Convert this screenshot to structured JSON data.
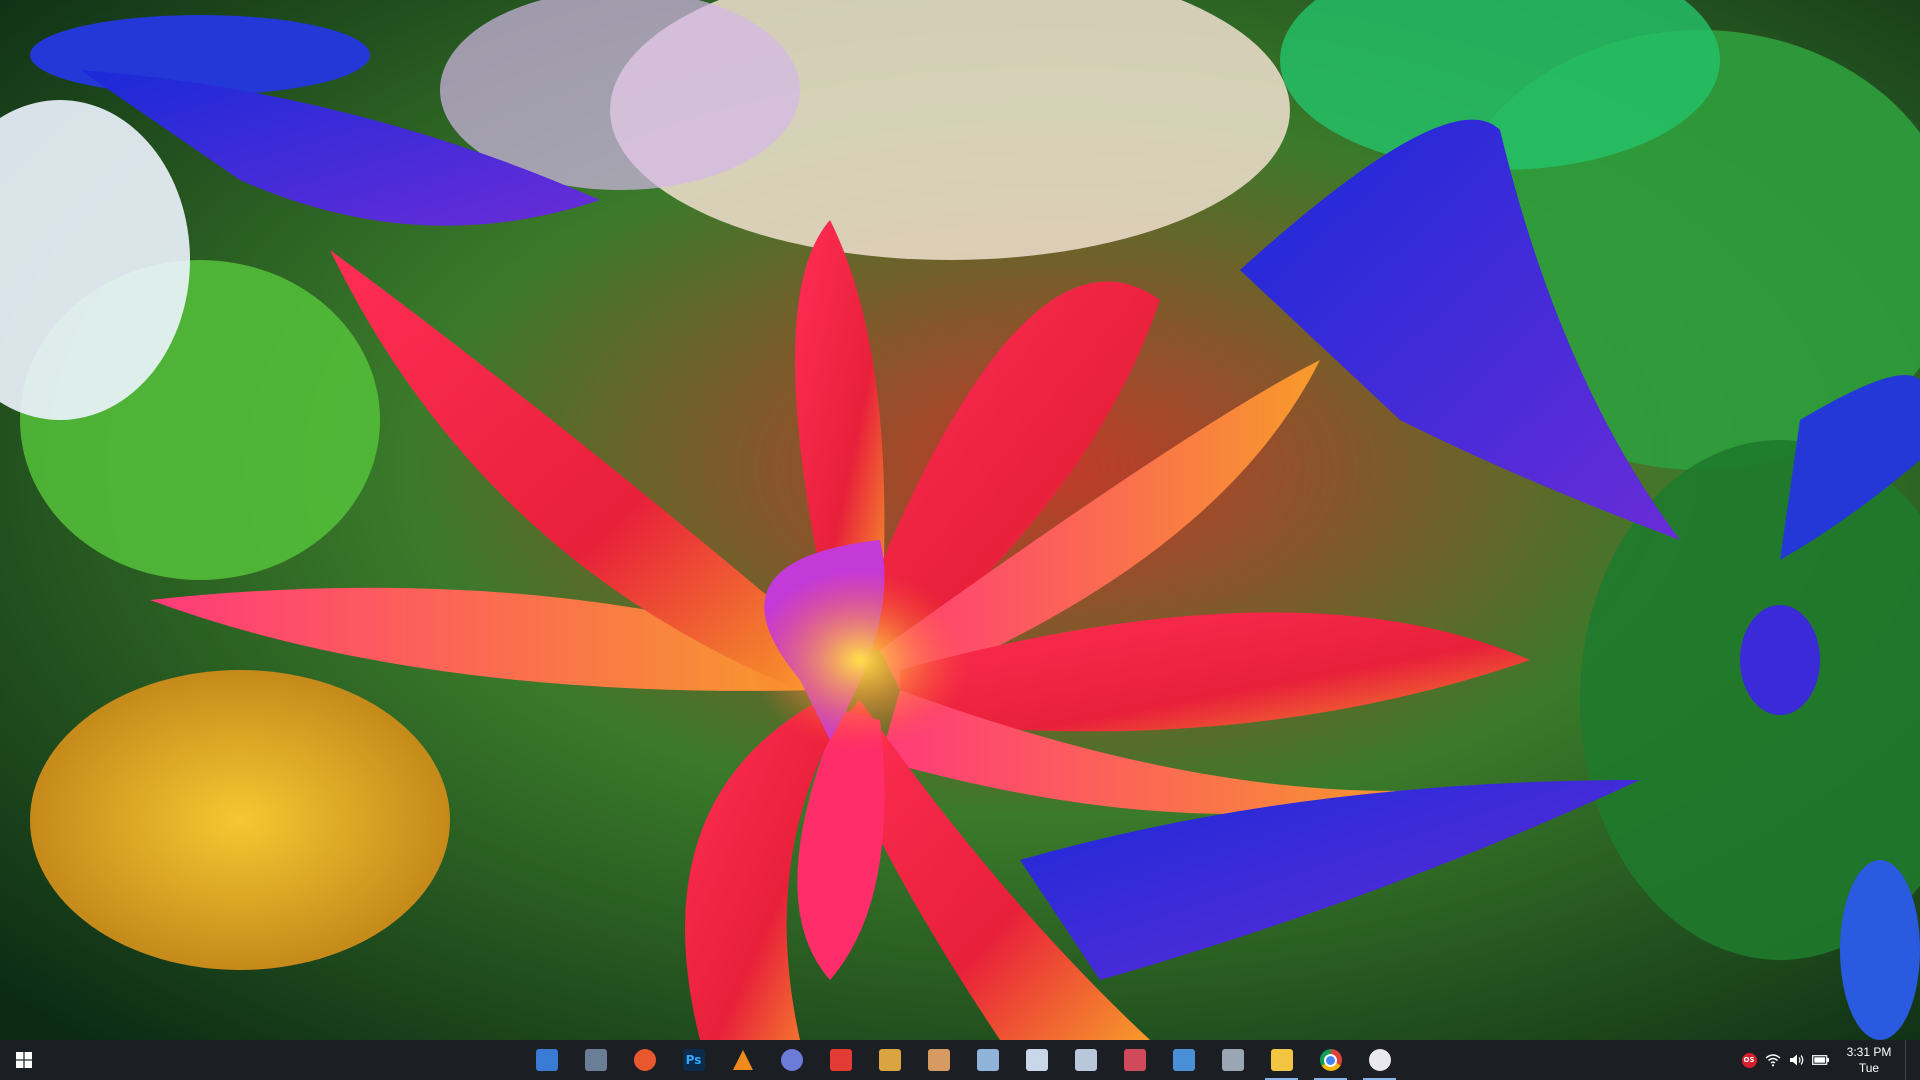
{
  "wallpaper": {
    "subject": "flowers",
    "colors": {
      "red": "#e8203a",
      "pink": "#f04a8c",
      "orange": "#f79b2a",
      "yellow": "#f2d03c",
      "blue": "#2438d8",
      "purple": "#7a2cc8",
      "green": "#2f9e3c",
      "teal": "#38c9a6",
      "cream": "#f1e0d0"
    }
  },
  "taskbar": {
    "background": "#1b1f23",
    "start": {
      "icon": "windows-icon"
    },
    "apps": [
      {
        "name": "app-updater",
        "icon": "blue-arrow-icon",
        "color": "#3a7bd5",
        "running": false
      },
      {
        "name": "app-cube",
        "icon": "cube-icon",
        "color": "#6a7f95",
        "running": false
      },
      {
        "name": "app-daemon",
        "icon": "orange-target-icon",
        "color": "#e8572e",
        "running": false
      },
      {
        "name": "app-photoshop",
        "icon": "photoshop-icon",
        "glyph": "Ps",
        "color": "#0d2b4a",
        "running": false
      },
      {
        "name": "app-vlc",
        "icon": "vlc-cone-icon",
        "color": "#f08a1c",
        "running": false
      },
      {
        "name": "app-browser-c",
        "icon": "spiral-icon",
        "color": "#6b7bd8",
        "running": false
      },
      {
        "name": "app-paint",
        "icon": "paint-icon",
        "color": "#e23a35",
        "running": false
      },
      {
        "name": "app-editor",
        "icon": "pencil-note-icon",
        "color": "#d9a441",
        "running": false
      },
      {
        "name": "app-palette",
        "icon": "palette-icon",
        "color": "#d69b62",
        "running": false
      },
      {
        "name": "app-notes",
        "icon": "notebook-icon",
        "color": "#8fb3d9",
        "running": false
      },
      {
        "name": "app-docs",
        "icon": "document-icon",
        "color": "#c9d7e8",
        "running": false
      },
      {
        "name": "app-calendar",
        "icon": "calendar-icon",
        "color": "#b8c7d9",
        "running": false
      },
      {
        "name": "app-media",
        "icon": "media-icon",
        "color": "#d04a5a",
        "running": false
      },
      {
        "name": "app-control",
        "icon": "control-panel-icon",
        "color": "#4a8fd9",
        "running": false
      },
      {
        "name": "app-network",
        "icon": "network-icon",
        "color": "#9aa6b3",
        "running": false
      },
      {
        "name": "app-explorer",
        "icon": "folder-icon",
        "color": "#f4c542",
        "running": true
      },
      {
        "name": "app-chrome",
        "icon": "chrome-icon",
        "color": "#db4437",
        "running": true
      },
      {
        "name": "app-itunes",
        "icon": "music-note-icon",
        "color": "#e8e8ee",
        "running": true
      }
    ],
    "tray": {
      "icons": [
        "red-os-badge-icon",
        "wifi-icon",
        "volume-icon",
        "battery-icon"
      ],
      "os_badge": "OS",
      "time": "3:31 PM",
      "day": "Tue"
    }
  }
}
